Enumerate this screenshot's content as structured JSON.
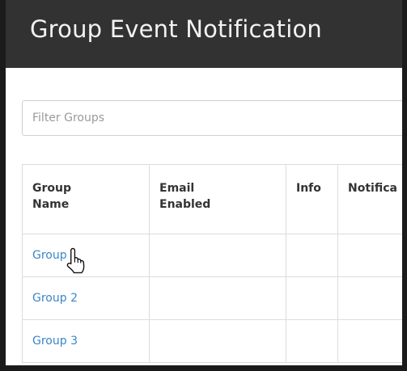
{
  "header": {
    "title": "Group Event Notification"
  },
  "filter": {
    "placeholder": "Filter Groups",
    "value": ""
  },
  "table": {
    "columns": [
      {
        "line1": "Group",
        "line2": "Name"
      },
      {
        "line1": "Email",
        "line2": "Enabled"
      },
      {
        "line1": "Info",
        "line2": ""
      },
      {
        "line1": "Notifica",
        "line2": ""
      }
    ],
    "rows": [
      {
        "group_name": "Group 1"
      },
      {
        "group_name": "Group 2"
      },
      {
        "group_name": "Group 3"
      }
    ]
  },
  "colors": {
    "header_bg": "#323232",
    "link": "#3a86c8"
  },
  "icons": {
    "cursor": "hand-pointer-icon"
  }
}
